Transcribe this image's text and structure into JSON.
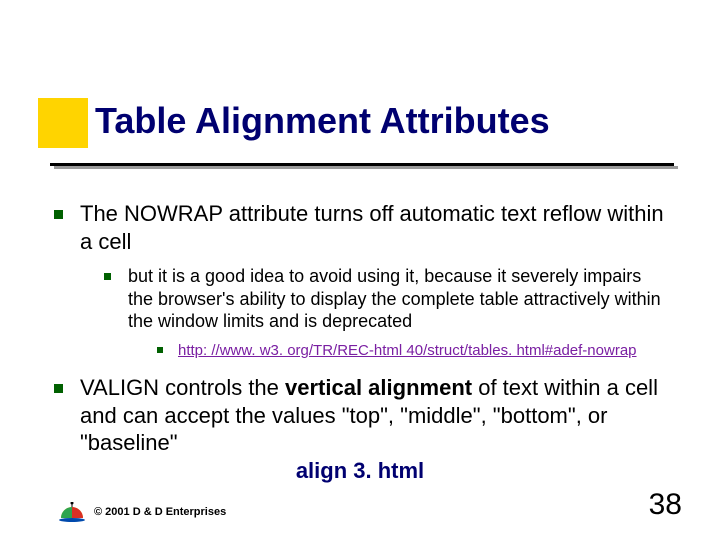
{
  "heading": "Table Alignment Attributes",
  "bullets": {
    "b1": {
      "text": "The NOWRAP attribute turns off automatic text reflow within a cell",
      "sub": {
        "s1": {
          "text": "but it is a good idea to avoid using it, because it severely impairs the browser's ability to display the complete table attractively within the window limits and is deprecated",
          "sub": {
            "link_text": "http: //www. w3. org/TR/REC-html 40/struct/tables. html#adef-nowrap"
          }
        }
      }
    },
    "b2": {
      "text_pre": "VALIGN controls the ",
      "text_bold": "vertical alignment",
      "text_post": " of text within a cell and can accept the values \"top\", \"middle\", \"bottom\", or \"baseline\""
    }
  },
  "file_label": "align 3. html",
  "footer": {
    "copyright": "© 2001 D & D Enterprises"
  },
  "page_number": "38"
}
